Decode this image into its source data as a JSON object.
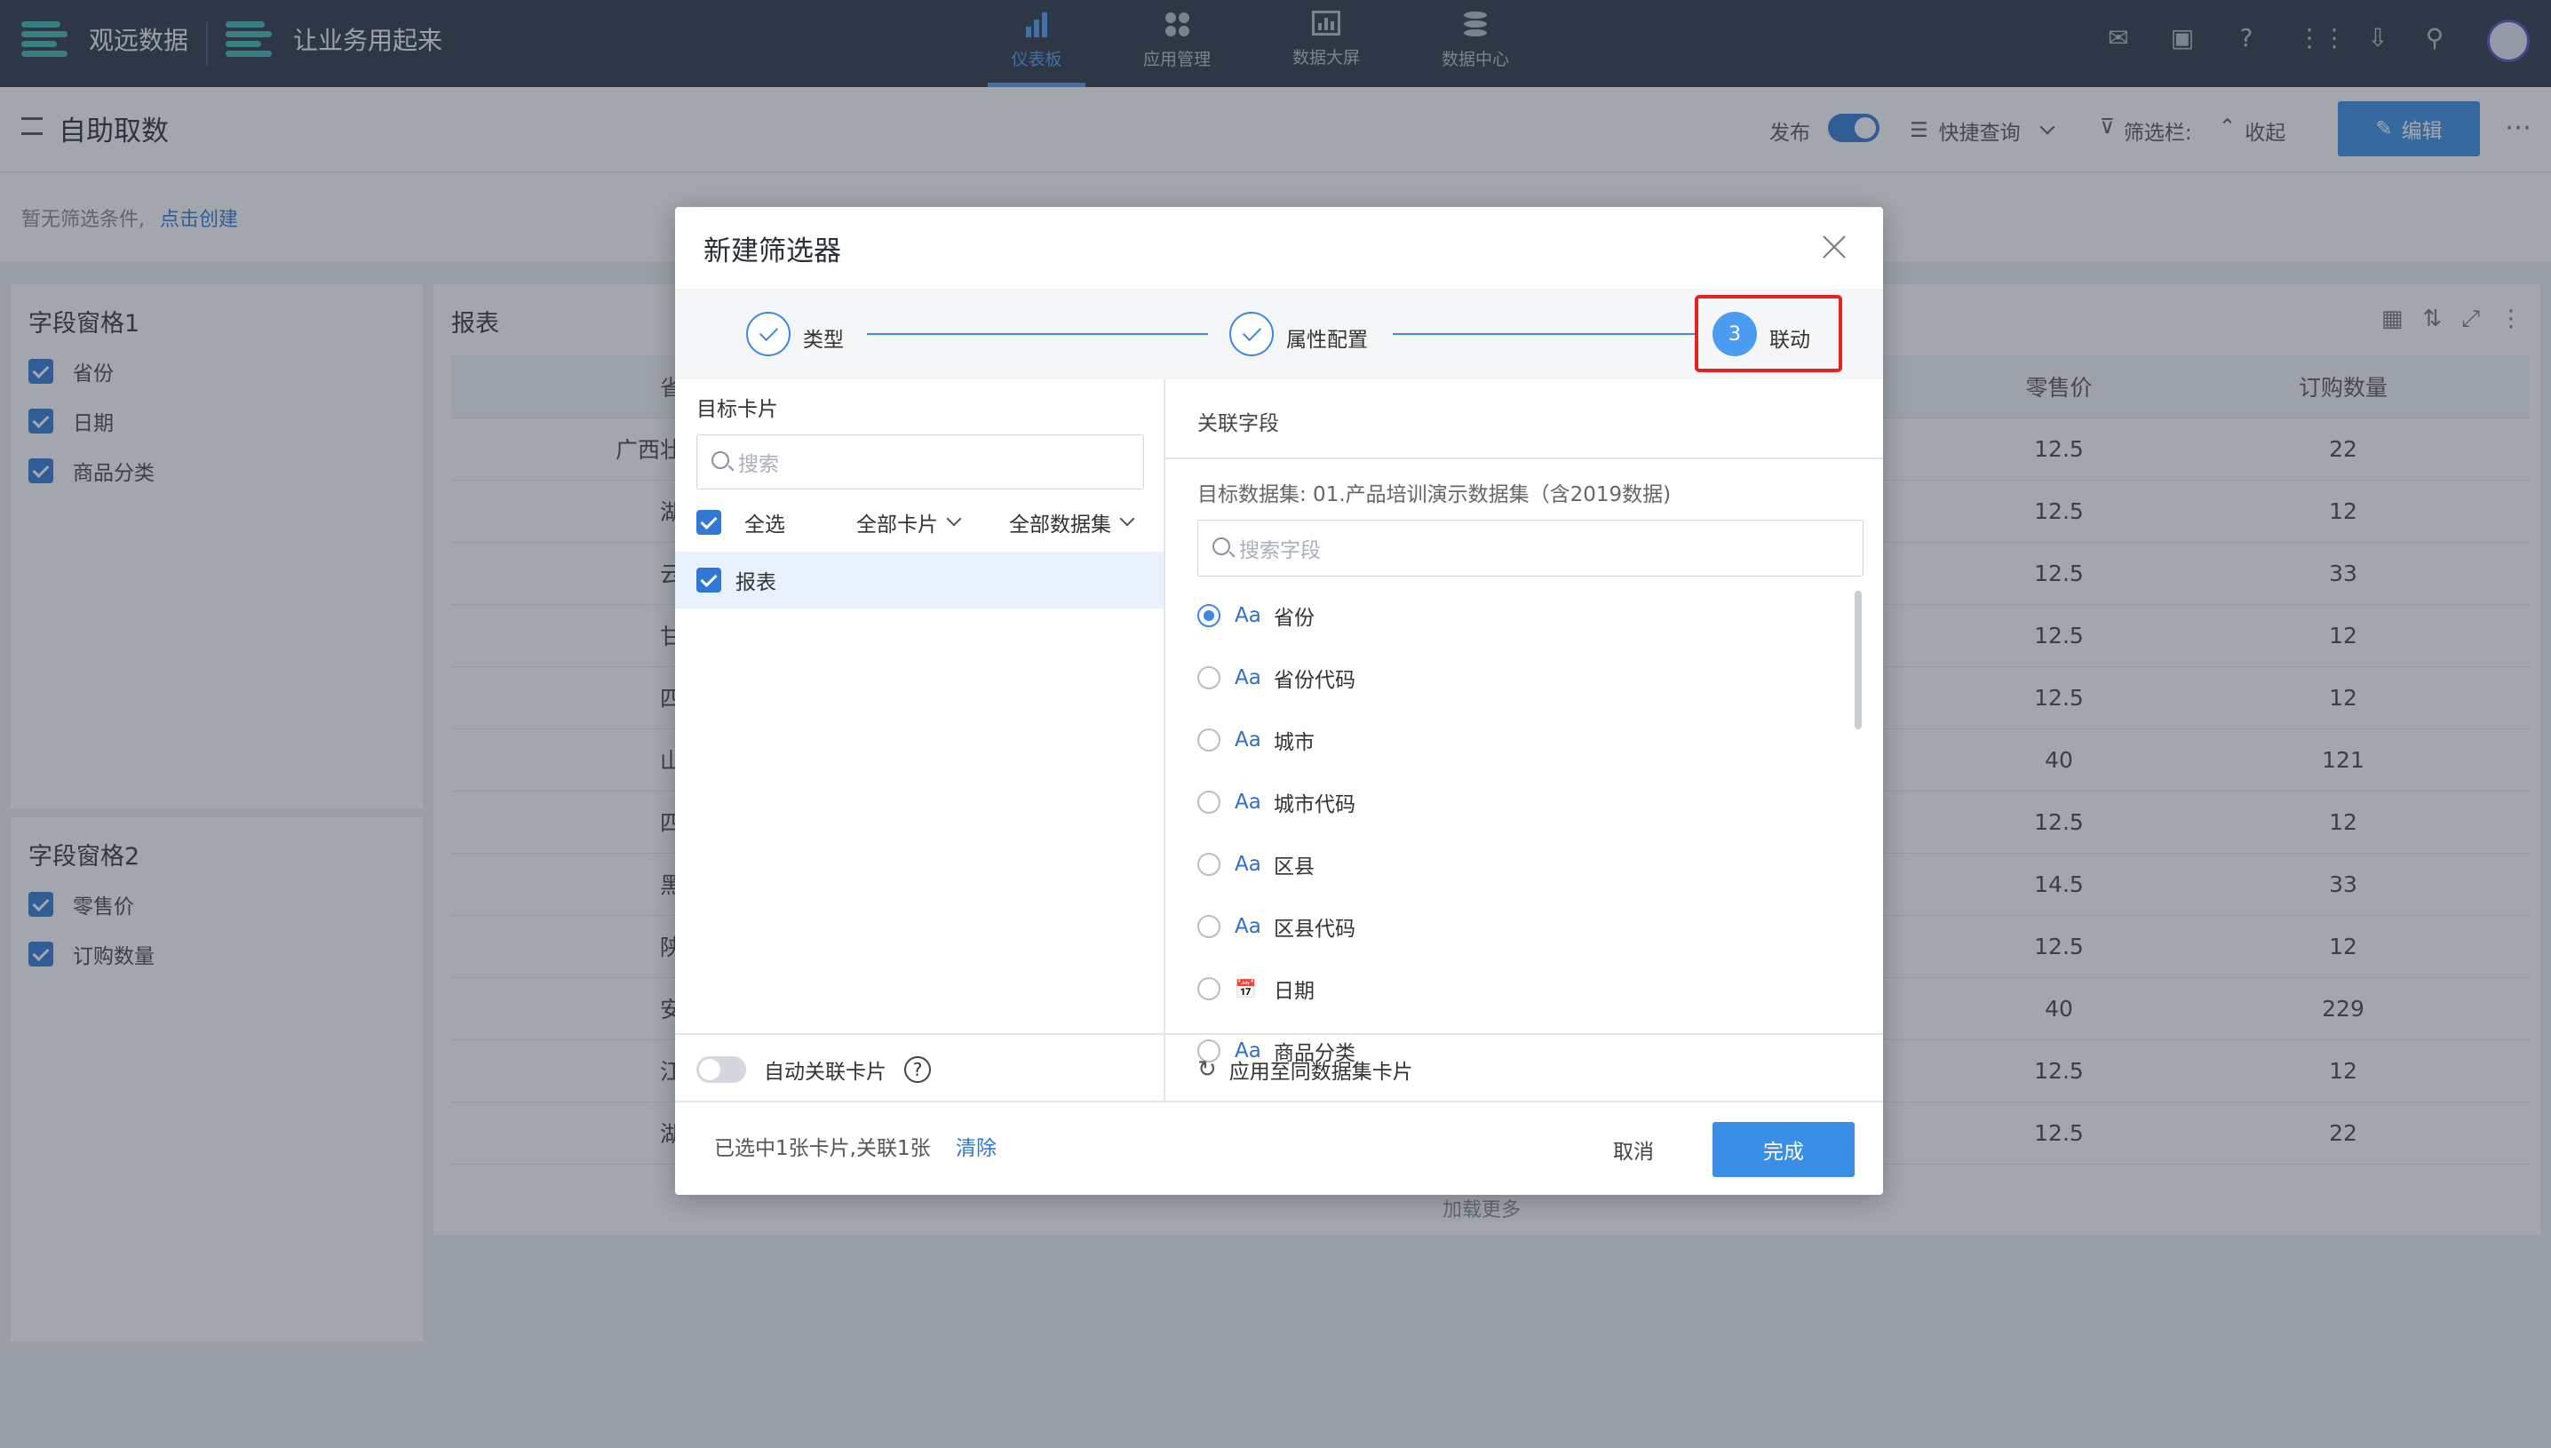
{
  "topbar": {
    "brand1": "观远数据",
    "brand2": "让业务用起来",
    "nav": [
      {
        "label": "仪表板",
        "active": true
      },
      {
        "label": "应用管理",
        "active": false
      },
      {
        "label": "数据大屏",
        "active": false
      },
      {
        "label": "数据中心",
        "active": false
      }
    ]
  },
  "header": {
    "title": "自助取数",
    "publish_label": "发布",
    "quick_query": "快捷查询",
    "filter_bar": "筛选栏:",
    "collapse": "收起",
    "edit": "编辑"
  },
  "filterbar": {
    "empty_text": "暂无筛选条件,",
    "create_link": "点击创建"
  },
  "pane1": {
    "title": "字段窗格1",
    "fields": [
      "省份",
      "日期",
      "商品分类"
    ]
  },
  "pane2": {
    "title": "字段窗格2",
    "fields": [
      "零售价",
      "订购数量"
    ]
  },
  "report": {
    "title": "报表",
    "columns": [
      "省",
      "零售价",
      "订购数量"
    ],
    "rows": [
      [
        "广西壮",
        "12.5",
        "22"
      ],
      [
        "湖",
        "12.5",
        "12"
      ],
      [
        "云",
        "12.5",
        "33"
      ],
      [
        "甘",
        "12.5",
        "12"
      ],
      [
        "四",
        "12.5",
        "12"
      ],
      [
        "山",
        "40",
        "121"
      ],
      [
        "四",
        "12.5",
        "12"
      ],
      [
        "黑",
        "14.5",
        "33"
      ],
      [
        "陕",
        "12.5",
        "12"
      ],
      [
        "安",
        "40",
        "229"
      ],
      [
        "江",
        "12.5",
        "12"
      ],
      [
        "湖",
        "12.5",
        "22"
      ]
    ],
    "load_more": "加载更多"
  },
  "modal": {
    "title": "新建筛选器",
    "steps": [
      {
        "label": "类型",
        "state": "done"
      },
      {
        "label": "属性配置",
        "state": "done"
      },
      {
        "label": "联动",
        "num": "3",
        "state": "current"
      }
    ],
    "left": {
      "title": "目标卡片",
      "search_placeholder": "搜索",
      "select_all": "全选",
      "filter_cards": "全部卡片",
      "filter_datasets": "全部数据集",
      "items": [
        "报表"
      ],
      "auto_link": "自动关联卡片"
    },
    "right": {
      "title": "关联字段",
      "dataset": "目标数据集: 01.产品培训演示数据集（含2019数据)",
      "search_placeholder": "搜索字段",
      "fields": [
        {
          "type": "Aa",
          "name": "省份",
          "selected": true
        },
        {
          "type": "Aa",
          "name": "省份代码",
          "selected": false
        },
        {
          "type": "Aa",
          "name": "城市",
          "selected": false
        },
        {
          "type": "Aa",
          "name": "城市代码",
          "selected": false
        },
        {
          "type": "Aa",
          "name": "区县",
          "selected": false
        },
        {
          "type": "Aa",
          "name": "区县代码",
          "selected": false
        },
        {
          "type": "date",
          "name": "日期",
          "selected": false
        },
        {
          "type": "Aa",
          "name": "商品分类",
          "selected": false
        }
      ],
      "apply_same": "应用至同数据集卡片"
    },
    "footer": {
      "summary": "已选中1张卡片,关联1张",
      "clear": "清除",
      "cancel": "取消",
      "done": "完成"
    }
  },
  "colors": {
    "accent": "#3a8ee6",
    "topbar": "#2b3444",
    "highlight": "#e52222"
  }
}
